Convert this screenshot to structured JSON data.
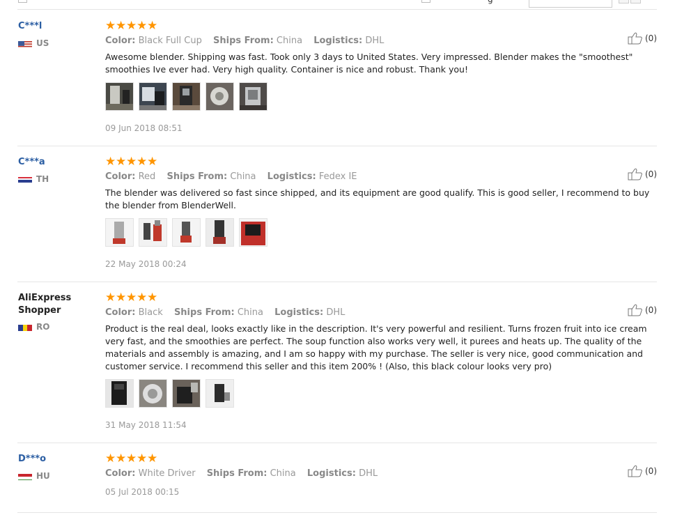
{
  "topbar": {
    "sort_label": "g"
  },
  "labels": {
    "color": "Color:",
    "ships_from": "Ships From:",
    "logistics": "Logistics:"
  },
  "feedbacks": [
    {
      "user": "C***l",
      "country_code": "US",
      "stars": 5,
      "color": "Black Full Cup",
      "ships_from": "China",
      "logistics": "DHL",
      "text": "Awesome blender. Shipping was fast. Took only 3 days to United States. Very impressed. Blender makes the \"smoothest\" smoothies Ive ever had. Very high quality. Container is nice and robust. Thank you!",
      "date": "09 Jun 2018 08:51",
      "helpful": "(0)",
      "photos": 5
    },
    {
      "user": "C***a",
      "country_code": "TH",
      "stars": 5,
      "color": "Red",
      "ships_from": "China",
      "logistics": "Fedex IE",
      "text": "The blender was delivered so fast since shipped, and its equipment are good qualify. This is good seller, I recommend to buy the blender from BlenderWell.",
      "date": "22 May 2018 00:24",
      "helpful": "(0)",
      "photos": 5
    },
    {
      "user": "AliExpress Shopper",
      "country_code": "RO",
      "stars": 5,
      "color": "Black",
      "ships_from": "China",
      "logistics": "DHL",
      "text": "Product is the real deal, looks exactly like in the description. It's very powerful and resilient. Turns frozen fruit into ice cream very fast, and the smoothies are perfect. The soup function also works very well, it purees and heats up. The quality of the materials and assembly is amazing, and I am so happy with my purchase. The seller is very nice, good communication and customer service. I recommend this seller and this item 200% ! (Also, this black colour looks very pro)",
      "date": "31 May 2018 11:54",
      "helpful": "(0)",
      "photos": 4
    },
    {
      "user": "D***o",
      "country_code": "HU",
      "stars": 5,
      "color": "White Driver",
      "ships_from": "China",
      "logistics": "DHL",
      "text": "",
      "date": "05 Jul 2018 00:15",
      "helpful": "(0)",
      "photos": 0
    }
  ]
}
